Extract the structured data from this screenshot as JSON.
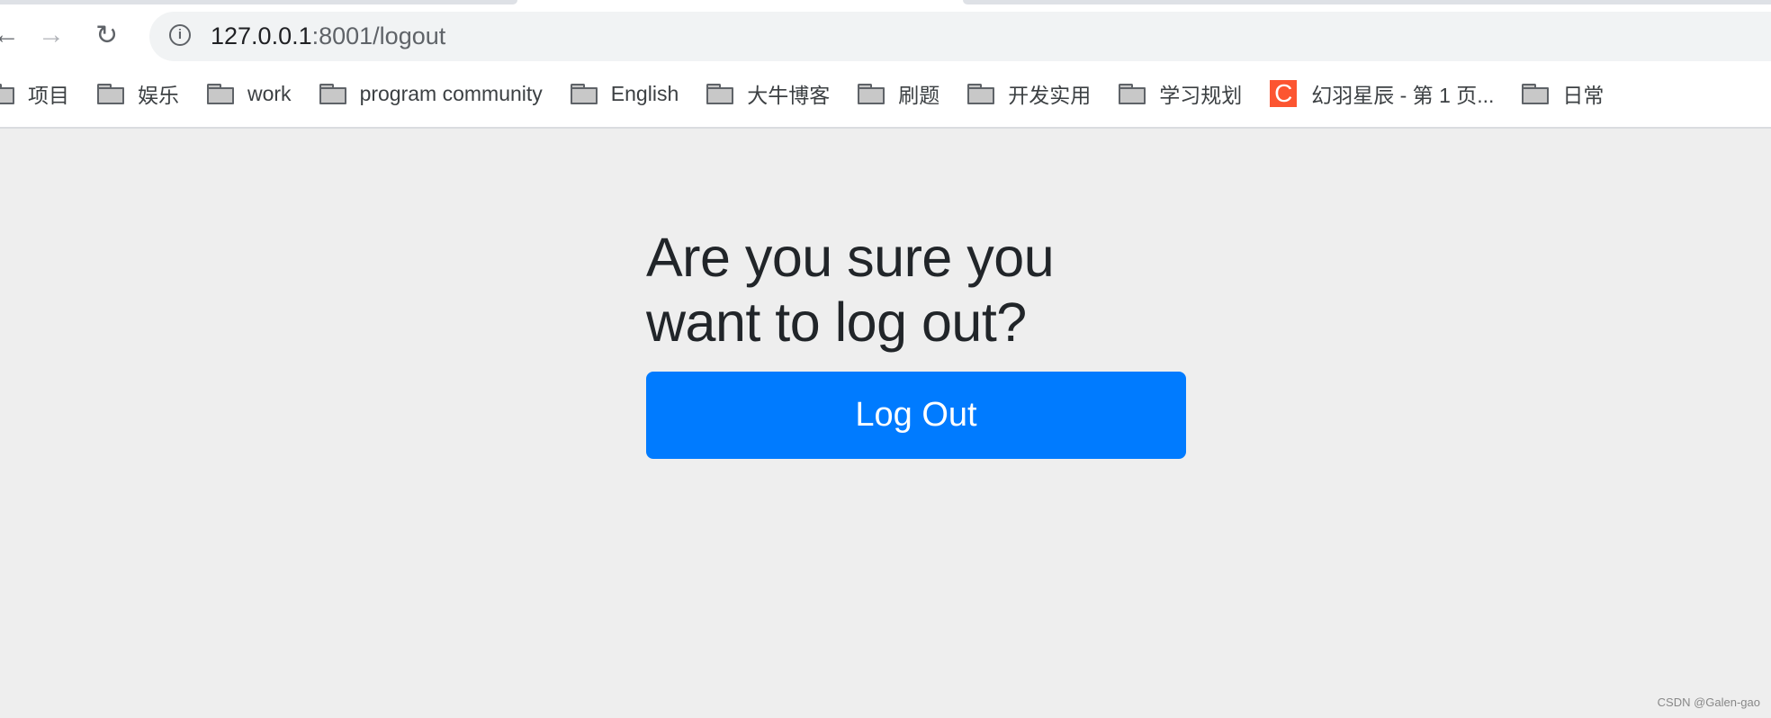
{
  "browser": {
    "url_host": "127.0.0.1",
    "url_rest": ":8001/logout",
    "bookmarks": [
      {
        "label": "项目",
        "icon": "folder-icon"
      },
      {
        "label": "娱乐",
        "icon": "folder-icon"
      },
      {
        "label": "work",
        "icon": "folder-icon"
      },
      {
        "label": "program community",
        "icon": "folder-icon"
      },
      {
        "label": "English",
        "icon": "folder-icon"
      },
      {
        "label": "大牛博客",
        "icon": "folder-icon"
      },
      {
        "label": "刷题",
        "icon": "folder-icon"
      },
      {
        "label": "开发实用",
        "icon": "folder-icon"
      },
      {
        "label": "学习规划",
        "icon": "folder-icon"
      },
      {
        "label": "幻羽星辰 - 第 1 页...",
        "icon": "csdn-icon",
        "icon_letter": "C"
      },
      {
        "label": "日常",
        "icon": "folder-icon"
      }
    ]
  },
  "page": {
    "heading": "Are you sure you want to log out?",
    "logout_button": "Log Out",
    "accent_color": "#007bff"
  },
  "watermark": "CSDN @Galen-gao"
}
